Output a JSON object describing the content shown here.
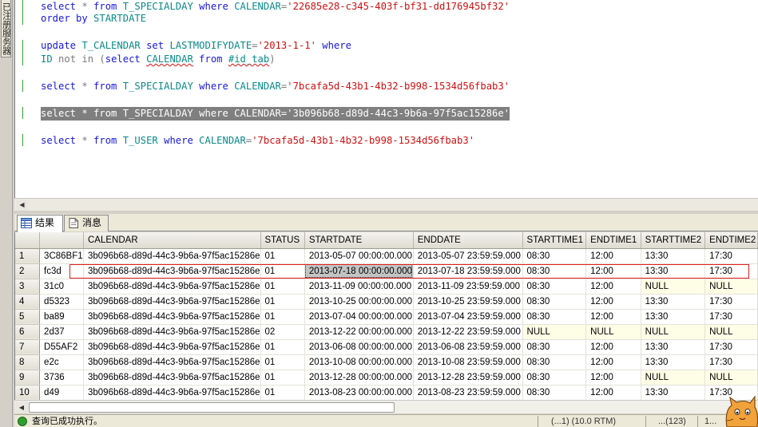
{
  "side_tab": {
    "label": "已注册服务器"
  },
  "editor": {
    "lines": [
      {
        "segments": [
          {
            "t": "select",
            "c": "kw"
          },
          {
            "t": " * ",
            "c": "op"
          },
          {
            "t": "from",
            "c": "kw"
          },
          {
            "t": " ",
            "c": ""
          },
          {
            "t": "T_SPECIALDAY",
            "c": "tbl"
          },
          {
            "t": " ",
            "c": ""
          },
          {
            "t": "where",
            "c": "kw"
          },
          {
            "t": " ",
            "c": ""
          },
          {
            "t": "CALENDAR",
            "c": "tbl"
          },
          {
            "t": "=",
            "c": "op"
          },
          {
            "t": "'22685e28-c345-403f-bf31-dd176945bf32'",
            "c": "str"
          }
        ]
      },
      {
        "segments": [
          {
            "t": "order by",
            "c": "kw"
          },
          {
            "t": " ",
            "c": ""
          },
          {
            "t": "STARTDATE",
            "c": "tbl"
          }
        ]
      },
      {
        "segments": [
          {
            "t": "update",
            "c": "kw"
          },
          {
            "t": " ",
            "c": ""
          },
          {
            "t": "T_CALENDAR",
            "c": "tbl"
          },
          {
            "t": " ",
            "c": ""
          },
          {
            "t": "set",
            "c": "kw"
          },
          {
            "t": " ",
            "c": ""
          },
          {
            "t": "LASTMODIFYDATE",
            "c": "tbl"
          },
          {
            "t": "=",
            "c": "op"
          },
          {
            "t": "'2013-1-1'",
            "c": "str"
          },
          {
            "t": " ",
            "c": ""
          },
          {
            "t": "where",
            "c": "kw"
          }
        ]
      },
      {
        "segments": [
          {
            "t": "ID",
            "c": "tbl"
          },
          {
            "t": " ",
            "c": ""
          },
          {
            "t": "not in",
            "c": "op"
          },
          {
            "t": " (",
            "c": "op"
          },
          {
            "t": "select",
            "c": "kw"
          },
          {
            "t": " ",
            "c": ""
          },
          {
            "t": "CALENDAR",
            "c": "tbl sq"
          },
          {
            "t": " ",
            "c": ""
          },
          {
            "t": "from",
            "c": "kw"
          },
          {
            "t": " ",
            "c": ""
          },
          {
            "t": "#id_tab",
            "c": "tbl sq"
          },
          {
            "t": ")",
            "c": "op"
          }
        ]
      },
      {
        "segments": [
          {
            "t": "select",
            "c": "kw"
          },
          {
            "t": " * ",
            "c": "op"
          },
          {
            "t": "from",
            "c": "kw"
          },
          {
            "t": " ",
            "c": ""
          },
          {
            "t": "T_SPECIALDAY",
            "c": "tbl"
          },
          {
            "t": " ",
            "c": ""
          },
          {
            "t": "where",
            "c": "kw"
          },
          {
            "t": " ",
            "c": ""
          },
          {
            "t": "CALENDAR",
            "c": "tbl"
          },
          {
            "t": "=",
            "c": "op"
          },
          {
            "t": "'7bcafa5d-43b1-4b32-b998-1534d56fbab3'",
            "c": "str"
          }
        ]
      },
      {
        "segments": [
          {
            "t": "select * from T_SPECIALDAY where CALENDAR='3b096b68-d89d-44c3-9b6a-97f5ac15286e'",
            "c": ""
          }
        ]
      },
      {
        "segments": [
          {
            "t": "select",
            "c": "kw"
          },
          {
            "t": " * ",
            "c": "op"
          },
          {
            "t": "from",
            "c": "kw"
          },
          {
            "t": " ",
            "c": ""
          },
          {
            "t": "T_USER",
            "c": "tbl"
          },
          {
            "t": " ",
            "c": ""
          },
          {
            "t": "where",
            "c": "kw"
          },
          {
            "t": " ",
            "c": ""
          },
          {
            "t": "CALENDAR",
            "c": "tbl"
          },
          {
            "t": "=",
            "c": "op"
          },
          {
            "t": "'7bcafa5d-43b1-4b32-b998-1534d56fbab3'",
            "c": "str"
          }
        ]
      }
    ]
  },
  "tabs": [
    {
      "label": "结果",
      "icon": "grid-icon"
    },
    {
      "label": "消息",
      "icon": "message-icon"
    }
  ],
  "grid": {
    "columns": [
      "",
      "CALENDAR",
      "STATUS",
      "STARTDATE",
      "ENDDATE",
      "STARTTIME1",
      "ENDTIME1",
      "STARTTIME2",
      "ENDTIME2"
    ],
    "rows": [
      [
        "1",
        "3C86BF1",
        "3b096b68-d89d-44c3-9b6a-97f5ac15286e",
        "01",
        "2013-05-07 00:00:00.000",
        "2013-05-07 23:59:59.000",
        "08:30",
        "12:00",
        "13:30",
        "17:30"
      ],
      [
        "2",
        "fc3d",
        "3b096b68-d89d-44c3-9b6a-97f5ac15286e",
        "01",
        "2013-07-18 00:00:00.000",
        "2013-07-18 23:59:59.000",
        "08:30",
        "12:00",
        "13:30",
        "17:30"
      ],
      [
        "3",
        "31c0",
        "3b096b68-d89d-44c3-9b6a-97f5ac15286e",
        "01",
        "2013-11-09 00:00:00.000",
        "2013-11-09 23:59:59.000",
        "08:30",
        "12:00",
        "NULL",
        "NULL"
      ],
      [
        "4",
        "d5323",
        "3b096b68-d89d-44c3-9b6a-97f5ac15286e",
        "01",
        "2013-10-25 00:00:00.000",
        "2013-10-25 23:59:59.000",
        "08:30",
        "12:00",
        "13:30",
        "17:30"
      ],
      [
        "5",
        "ba89",
        "3b096b68-d89d-44c3-9b6a-97f5ac15286e",
        "01",
        "2013-07-04 00:00:00.000",
        "2013-07-04 23:59:59.000",
        "08:30",
        "12:00",
        "13:30",
        "17:30"
      ],
      [
        "6",
        "2d37",
        "3b096b68-d89d-44c3-9b6a-97f5ac15286e",
        "02",
        "2013-12-22 00:00:00.000",
        "2013-12-22 23:59:59.000",
        "NULL",
        "NULL",
        "NULL",
        "NULL"
      ],
      [
        "7",
        "D55AF2",
        "3b096b68-d89d-44c3-9b6a-97f5ac15286e",
        "01",
        "2013-06-08 00:00:00.000",
        "2013-06-08 23:59:59.000",
        "08:30",
        "12:00",
        "13:30",
        "17:30"
      ],
      [
        "8",
        "e2c",
        "3b096b68-d89d-44c3-9b6a-97f5ac15286e",
        "01",
        "2013-10-08 00:00:00.000",
        "2013-10-08 23:59:59.000",
        "08:30",
        "12:00",
        "13:30",
        "17:30"
      ],
      [
        "9",
        "3736",
        "3b096b68-d89d-44c3-9b6a-97f5ac15286e",
        "01",
        "2013-12-28 00:00:00.000",
        "2013-12-28 23:59:59.000",
        "08:30",
        "12:00",
        "NULL",
        "NULL"
      ],
      [
        "10",
        "d49",
        "3b096b68-d89d-44c3-9b6a-97f5ac15286e",
        "01",
        "2013-08-23 00:00:00.000",
        "2013-08-23 23:59:59.000",
        "08:30",
        "12:00",
        "13:30",
        "17:30"
      ]
    ],
    "selected_row": 2,
    "selected_cell": "2013-07-18 00:00:00.000"
  },
  "statusbar": {
    "message": "查询已成功执行。",
    "segments": [
      "(...1) (10.0 RTM)",
      "...(123)",
      "1..."
    ]
  },
  "colors": {
    "keyword": "#1818d8",
    "string": "#d01010",
    "identifier": "#0a8a8a",
    "highlight_box": "#e02020",
    "null_cell": "#fefde6",
    "status_ok": "#2f9e2f"
  }
}
